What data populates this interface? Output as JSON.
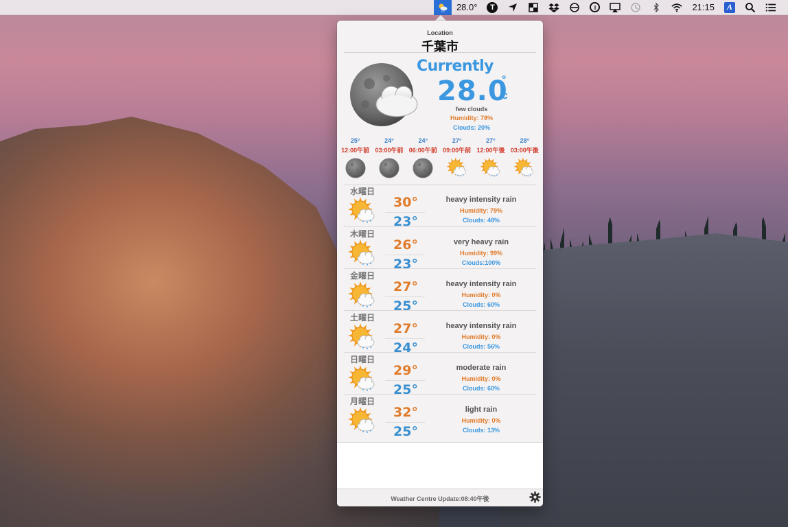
{
  "menubar": {
    "weather_temp": "28.0°",
    "clock": "21:15",
    "items": [
      "weather-icon",
      "typinator-icon",
      "location-arrow-icon",
      "window-icon",
      "dropbox-icon",
      "sync-icon",
      "info-icon",
      "airplay-icon",
      "time-machine-icon",
      "bluetooth-icon",
      "wifi-icon",
      "input-source-icon",
      "spotlight-icon",
      "notification-center-icon"
    ],
    "t_label": "T",
    "i_label": "i",
    "a_label": "A"
  },
  "popover": {
    "location_label": "Location",
    "location_name": "千葉市",
    "currently_label": "Currently",
    "current": {
      "temp": "28.0",
      "deg": "°",
      "unit": "c",
      "description": "few clouds",
      "humidity": "Humidity: 78%",
      "clouds": "Clouds: 20%",
      "icon": "moon-cloud-icon"
    },
    "hourly": [
      {
        "temp": "25°",
        "time": "12:00午前",
        "icon": "moon-icon"
      },
      {
        "temp": "24°",
        "time": "03:00午前",
        "icon": "moon-icon"
      },
      {
        "temp": "24°",
        "time": "06:00午前",
        "icon": "moon-icon"
      },
      {
        "temp": "27°",
        "time": "09:00午前",
        "icon": "sun-cloud-rain-icon"
      },
      {
        "temp": "27°",
        "time": "12:00午後",
        "icon": "sun-cloud-rain-icon"
      },
      {
        "temp": "28°",
        "time": "03:00午後",
        "icon": "sun-cloud-rain-icon"
      }
    ],
    "days": [
      {
        "name": "水曜日",
        "hi": "30°",
        "lo": "23°",
        "desc": "heavy intensity rain",
        "humidity": "Humidity: 79%",
        "clouds": "Clouds: 48%",
        "icon": "sun-cloud-rain-icon"
      },
      {
        "name": "木曜日",
        "hi": "26°",
        "lo": "23°",
        "desc": "very heavy rain",
        "humidity": "Humidity: 99%",
        "clouds": "Clouds:100%",
        "icon": "sun-cloud-rain-icon"
      },
      {
        "name": "金曜日",
        "hi": "27°",
        "lo": "25°",
        "desc": "heavy intensity rain",
        "humidity": "Humidity: 0%",
        "clouds": "Clouds: 60%",
        "icon": "sun-cloud-rain-icon"
      },
      {
        "name": "土曜日",
        "hi": "27°",
        "lo": "24°",
        "desc": "heavy intensity rain",
        "humidity": "Humidity: 0%",
        "clouds": "Clouds: 56%",
        "icon": "sun-cloud-rain-icon"
      },
      {
        "name": "日曜日",
        "hi": "29°",
        "lo": "25°",
        "desc": "moderate rain",
        "humidity": "Humidity: 0%",
        "clouds": "Clouds: 60%",
        "icon": "sun-cloud-rain-icon"
      },
      {
        "name": "月曜日",
        "hi": "32°",
        "lo": "25°",
        "desc": "light rain",
        "humidity": "Humidity: 0%",
        "clouds": "Clouds: 13%",
        "icon": "sun-cloud-rain-icon"
      }
    ],
    "footer": "Weather Centre Update:08:40午後"
  },
  "colors": {
    "blue": "#3a97e0",
    "orange": "#e07b2a",
    "red": "#d23a2a",
    "menubar_highlight": "#2a6fd6"
  }
}
